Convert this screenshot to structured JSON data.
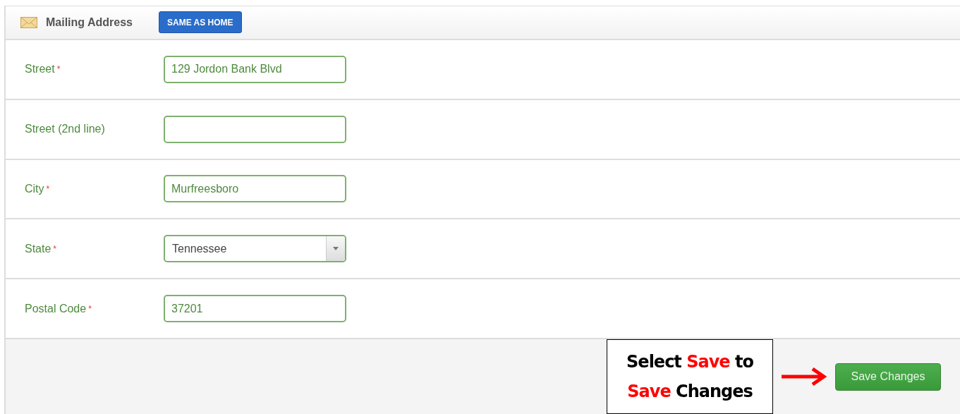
{
  "section": {
    "title": "Mailing Address",
    "button": "SAME AS HOME"
  },
  "fields": [
    {
      "kind": "text",
      "label": "Street",
      "required_mark": "*",
      "value": "129 Jordon Bank Blvd"
    },
    {
      "kind": "text",
      "label": "Street (2nd line)"
    },
    {
      "kind": "text",
      "label": "City",
      "required_mark": "*",
      "value": "Murfreesboro"
    },
    {
      "kind": "select",
      "label": "State",
      "required_mark": "*",
      "value": "Tennessee"
    },
    {
      "kind": "text",
      "label": "Postal Code",
      "required_mark": "*",
      "value": "37201"
    }
  ],
  "callout": {
    "lines": [
      [
        {
          "text": "Select ",
          "highlight": false
        },
        {
          "text": "Save",
          "highlight": true
        },
        {
          "text": " to",
          "highlight": false
        }
      ],
      [
        {
          "text": "Save",
          "highlight": true
        },
        {
          "text": " Changes",
          "highlight": false
        }
      ]
    ]
  },
  "save_button": "Save Changes"
}
